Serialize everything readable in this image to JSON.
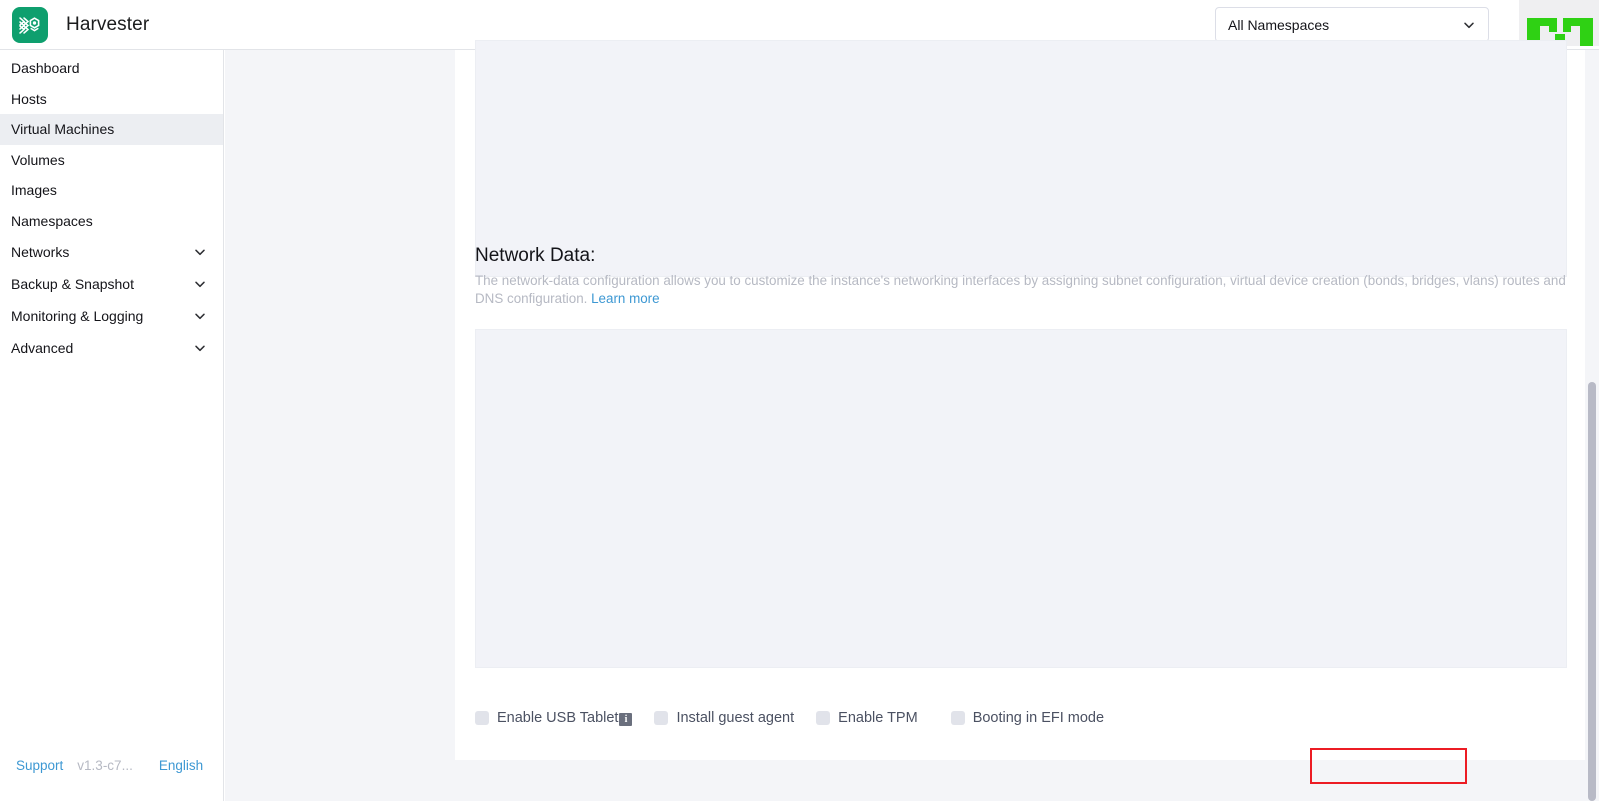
{
  "header": {
    "brand_name": "Harvester",
    "logo_icon": "harvester-logo-icon",
    "namespace_selector": {
      "value": "All Namespaces",
      "chevron_icon": "chevron-down-icon"
    },
    "rancher_logo_icon": "rancher-logo-icon"
  },
  "sidebar": {
    "items": [
      {
        "label": "Dashboard",
        "active": false,
        "expandable": false
      },
      {
        "label": "Hosts",
        "active": false,
        "expandable": false
      },
      {
        "label": "Virtual Machines",
        "active": true,
        "expandable": false
      },
      {
        "label": "Volumes",
        "active": false,
        "expandable": false
      },
      {
        "label": "Images",
        "active": false,
        "expandable": false
      },
      {
        "label": "Namespaces",
        "active": false,
        "expandable": false
      },
      {
        "label": "Networks",
        "active": false,
        "expandable": true
      },
      {
        "label": "Backup & Snapshot",
        "active": false,
        "expandable": true
      },
      {
        "label": "Monitoring & Logging",
        "active": false,
        "expandable": true
      },
      {
        "label": "Advanced",
        "active": false,
        "expandable": true
      }
    ],
    "footer": {
      "support_label": "Support",
      "version_label": "v1.3-c7...",
      "language_label": "English"
    }
  },
  "main": {
    "user_data_editor": {
      "name": "user-data-editor",
      "value": ""
    },
    "network_data": {
      "title": "Network Data:",
      "description": "The network-data configuration allows you to customize the instance's networking interfaces by assigning subnet configuration, virtual device creation (bonds, bridges, vlans) routes and DNS configuration. ",
      "learn_more_label": "Learn more",
      "editor_value": ""
    },
    "checkboxes": [
      {
        "label": "Enable USB Tablet",
        "checked": false,
        "has_info_icon": true,
        "info_glyph": "i",
        "highlighted": false
      },
      {
        "label": "Install guest agent",
        "checked": false,
        "has_info_icon": false,
        "info_glyph": "",
        "highlighted": false
      },
      {
        "label": "Enable TPM",
        "checked": false,
        "has_info_icon": false,
        "info_glyph": "",
        "highlighted": false
      },
      {
        "label": "Booting in EFI mode",
        "checked": false,
        "has_info_icon": false,
        "info_glyph": "",
        "highlighted": true
      }
    ]
  },
  "colors": {
    "brand_green": "#0e9f6e",
    "rancher_green": "#2fd114",
    "link_blue": "#3d98d3",
    "highlight_red": "#ec1c24",
    "editor_bg": "#f2f3f8",
    "sidebar_active_bg": "#eceef2",
    "muted_text": "#b6b9c3"
  },
  "scrollbar": {
    "name": "page-scrollbar"
  }
}
